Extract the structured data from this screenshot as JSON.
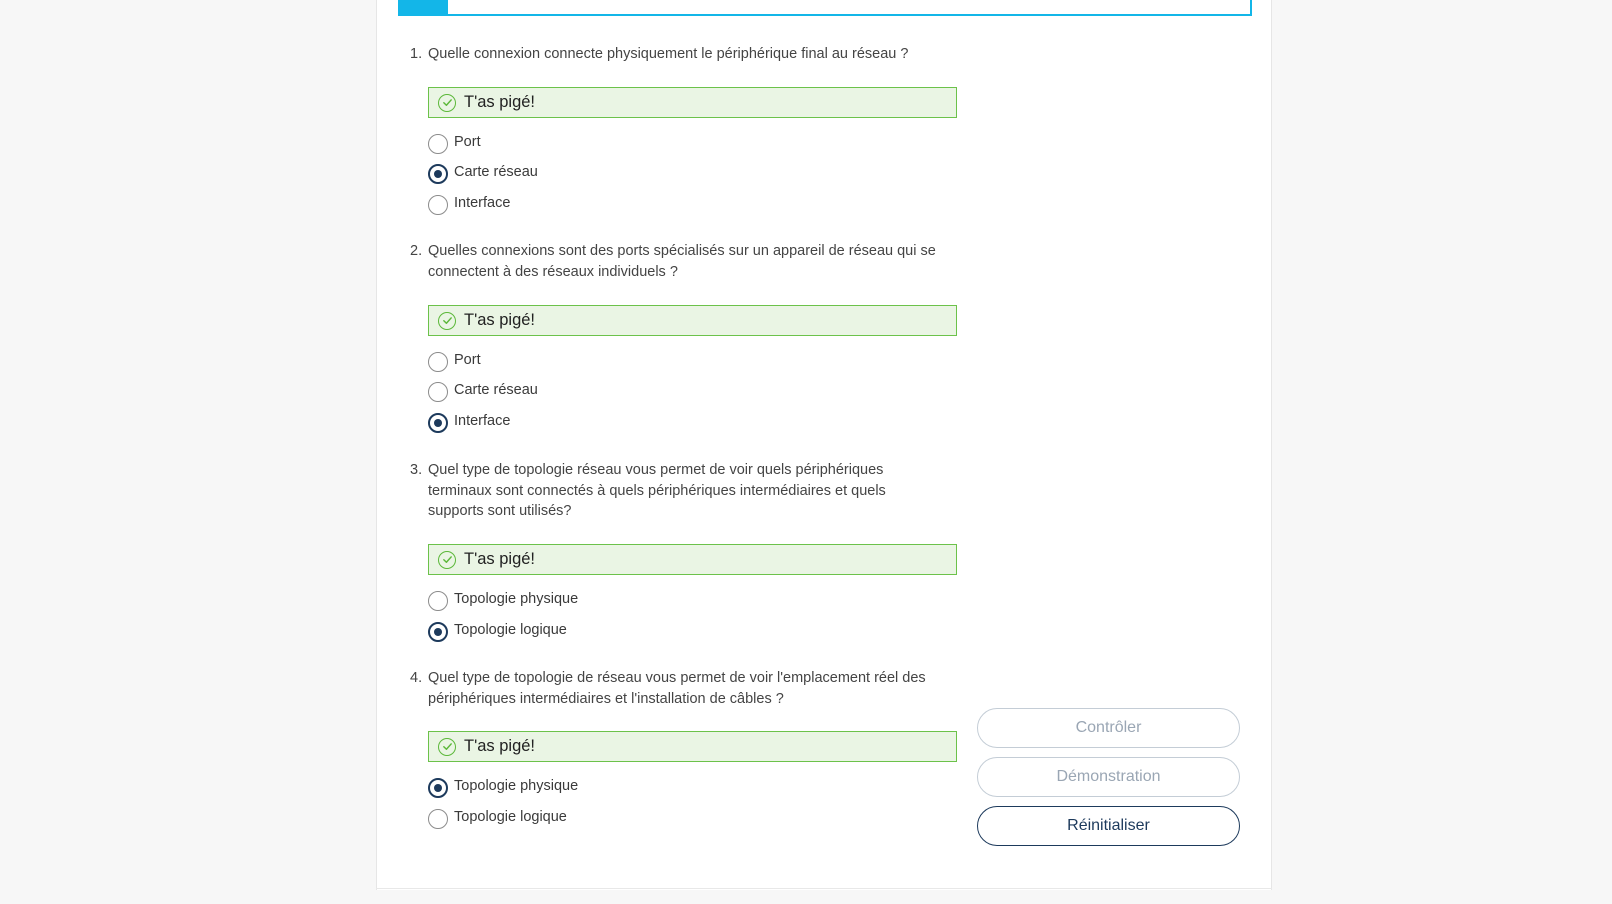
{
  "feedback_icon": "check-circle-icon",
  "colors": {
    "accent": "#13b6e8",
    "success_bg": "#eaf5e4",
    "success_border": "#6cc24a",
    "primary": "#1d3a5c"
  },
  "questions": [
    {
      "number": "1.",
      "text": "Quelle connexion connecte physiquement le périphérique final au réseau ?",
      "feedback": "T'as pigé!",
      "options": [
        {
          "label": "Port",
          "selected": false
        },
        {
          "label": "Carte réseau",
          "selected": true
        },
        {
          "label": "Interface",
          "selected": false
        }
      ]
    },
    {
      "number": "2.",
      "text": "Quelles connexions sont des ports spécialisés sur un appareil de réseau qui se connectent à des réseaux individuels ?",
      "feedback": "T'as pigé!",
      "options": [
        {
          "label": "Port",
          "selected": false
        },
        {
          "label": "Carte réseau",
          "selected": false
        },
        {
          "label": "Interface",
          "selected": true
        }
      ]
    },
    {
      "number": "3.",
      "text": "Quel type de topologie réseau vous permet de voir quels périphériques terminaux sont connectés à quels périphériques intermédiaires et quels supports sont utilisés?",
      "feedback": "T'as pigé!",
      "options": [
        {
          "label": "Topologie physique",
          "selected": false
        },
        {
          "label": "Topologie logique",
          "selected": true
        }
      ]
    },
    {
      "number": "4.",
      "text": "Quel type de topologie de réseau vous permet de voir l'emplacement réel des périphériques intermédiaires et l'installation de câbles ?",
      "feedback": "T'as pigé!",
      "options": [
        {
          "label": "Topologie physique",
          "selected": true
        },
        {
          "label": "Topologie logique",
          "selected": false
        }
      ]
    }
  ],
  "buttons": {
    "check": "Contrôler",
    "demo": "Démonstration",
    "reset": "Réinitialiser"
  }
}
